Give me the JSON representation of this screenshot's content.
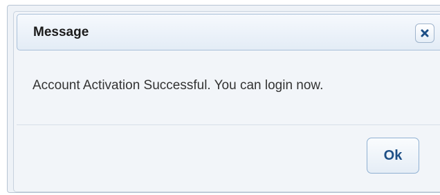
{
  "dialog": {
    "title": "Message",
    "message": "Account Activation Successful. You can login now.",
    "ok_label": "Ok",
    "close_icon": "close-icon"
  },
  "colors": {
    "accent_text": "#1d4f86",
    "titlebar_border": "#a9c0d9",
    "close_icon": "#1d4f86"
  }
}
